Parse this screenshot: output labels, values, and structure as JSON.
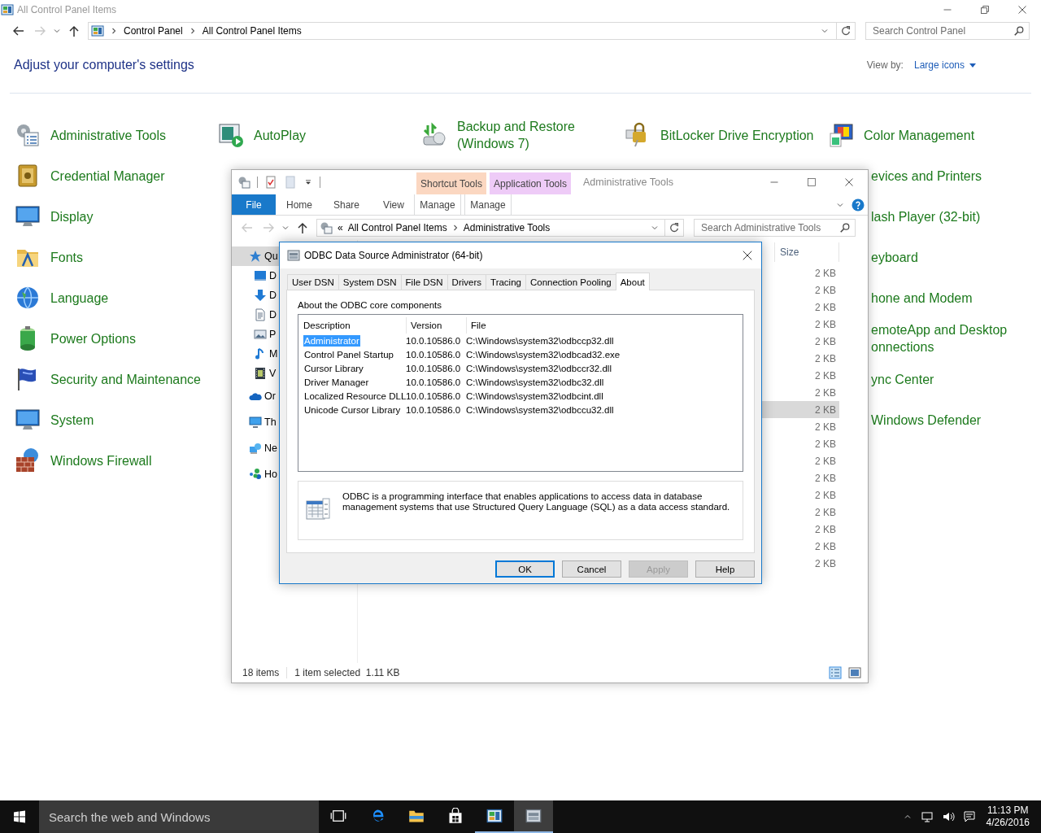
{
  "control_panel": {
    "title": "All Control Panel Items",
    "breadcrumb": [
      "Control Panel",
      "All Control Panel Items"
    ],
    "search_placeholder": "Search Control Panel",
    "heading": "Adjust your computer's settings",
    "view_by_label": "View by:",
    "view_by_value": "Large icons",
    "top_items": [
      "Administrative Tools",
      "AutoPlay",
      "Backup and Restore (Windows 7)",
      "BitLocker Drive Encryption",
      "Color Management"
    ],
    "left_items": [
      "Credential Manager",
      "Display",
      "Fonts",
      "Language",
      "Power Options",
      "Security and Maintenance",
      "System",
      "Windows Firewall"
    ],
    "right_items": [
      "evices and Printers",
      "lash Player (32-bit)",
      "eyboard",
      "hone and Modem",
      "emoteApp and Desktop onnections",
      "ync Center",
      "Windows Defender"
    ]
  },
  "explorer": {
    "contextual_tabs": [
      {
        "label": "Shortcut Tools",
        "sub": "Manage",
        "color": "#fbd7c1"
      },
      {
        "label": "Application Tools",
        "sub": "Manage",
        "color": "#eecbf7"
      }
    ],
    "title": "Administrative Tools",
    "ribbon_tabs": [
      {
        "label": "File",
        "kind": "file"
      },
      {
        "label": "Home",
        "kind": "tab"
      },
      {
        "label": "Share",
        "kind": "tab"
      },
      {
        "label": "View",
        "kind": "tab"
      }
    ],
    "address_overflow": "«",
    "address": [
      "All Control Panel Items",
      "Administrative Tools"
    ],
    "search_placeholder": "Search Administrative Tools",
    "nav": [
      {
        "label": "Qu",
        "selected": true,
        "children": [
          {
            "label": "D",
            "selected": false
          },
          {
            "label": "D",
            "selected": false
          },
          {
            "label": "D",
            "selected": false
          },
          {
            "label": "P",
            "selected": false
          },
          {
            "label": "M",
            "selected": false
          },
          {
            "label": "V",
            "selected": false
          }
        ]
      },
      {
        "label": "Or",
        "selected": false
      },
      {
        "label": "Th",
        "selected": false
      },
      {
        "label": "Ne",
        "selected": false
      },
      {
        "label": "Ho",
        "selected": false
      }
    ],
    "size_header": "Size",
    "sizes": [
      {
        "value": "2 KB",
        "selected": false
      },
      {
        "value": "2 KB",
        "selected": false
      },
      {
        "value": "2 KB",
        "selected": false
      },
      {
        "value": "2 KB",
        "selected": false
      },
      {
        "value": "2 KB",
        "selected": false
      },
      {
        "value": "2 KB",
        "selected": false
      },
      {
        "value": "2 KB",
        "selected": false
      },
      {
        "value": "2 KB",
        "selected": false
      },
      {
        "value": "2 KB",
        "selected": true
      },
      {
        "value": "2 KB",
        "selected": false
      },
      {
        "value": "2 KB",
        "selected": false
      },
      {
        "value": "2 KB",
        "selected": false
      },
      {
        "value": "2 KB",
        "selected": false
      },
      {
        "value": "2 KB",
        "selected": false
      },
      {
        "value": "2 KB",
        "selected": false
      },
      {
        "value": "2 KB",
        "selected": false
      },
      {
        "value": "2 KB",
        "selected": false
      },
      {
        "value": "2 KB",
        "selected": false
      }
    ],
    "status_count": "18 items",
    "status_selection": "1 item selected  1.11 KB"
  },
  "dialog": {
    "title": "ODBC Data Source Administrator (64-bit)",
    "tabs": [
      {
        "label": "User DSN",
        "selected": false
      },
      {
        "label": "System DSN",
        "selected": false
      },
      {
        "label": "File DSN",
        "selected": false
      },
      {
        "label": "Drivers",
        "selected": false
      },
      {
        "label": "Tracing",
        "selected": false
      },
      {
        "label": "Connection Pooling",
        "selected": false
      },
      {
        "label": "About",
        "selected": true
      }
    ],
    "section_label": "About the ODBC core components",
    "columns": [
      "Description",
      "Version",
      "File"
    ],
    "rows": [
      {
        "description": "Administrator",
        "version": "10.0.10586.0",
        "file": "C:\\Windows\\system32\\odbccp32.dll",
        "selected": true
      },
      {
        "description": "Control Panel Startup",
        "version": "10.0.10586.0",
        "file": "C:\\Windows\\system32\\odbcad32.exe",
        "selected": false
      },
      {
        "description": "Cursor Library",
        "version": "10.0.10586.0",
        "file": "C:\\Windows\\system32\\odbccr32.dll",
        "selected": false
      },
      {
        "description": "Driver Manager",
        "version": "10.0.10586.0",
        "file": "C:\\Windows\\system32\\odbc32.dll",
        "selected": false
      },
      {
        "description": "Localized Resource DLL",
        "version": "10.0.10586.0",
        "file": "C:\\Windows\\system32\\odbcint.dll",
        "selected": false
      },
      {
        "description": "Unicode Cursor Library",
        "version": "10.0.10586.0",
        "file": "C:\\Windows\\system32\\odbccu32.dll",
        "selected": false
      }
    ],
    "info_text": "ODBC is a programming interface that enables applications to access data in database management systems that use Structured Query Language (SQL) as a data access standard.",
    "buttons": [
      {
        "label": "OK",
        "kind": "default"
      },
      {
        "label": "Cancel",
        "kind": "normal"
      },
      {
        "label": "Apply",
        "kind": "disabled"
      },
      {
        "label": "Help",
        "kind": "normal"
      }
    ]
  },
  "taskbar": {
    "search_placeholder": "Search the web and Windows",
    "apps": [
      {
        "kind": "taskview",
        "running": false,
        "selected": false
      },
      {
        "kind": "edge",
        "running": false,
        "selected": false
      },
      {
        "kind": "explorer",
        "running": false,
        "selected": false
      },
      {
        "kind": "store",
        "running": false,
        "selected": false
      },
      {
        "kind": "controlpanel",
        "running": true,
        "selected": false
      },
      {
        "kind": "odbc",
        "running": true,
        "selected": true
      }
    ],
    "time": "11:13 PM",
    "date": "4/26/2016"
  }
}
